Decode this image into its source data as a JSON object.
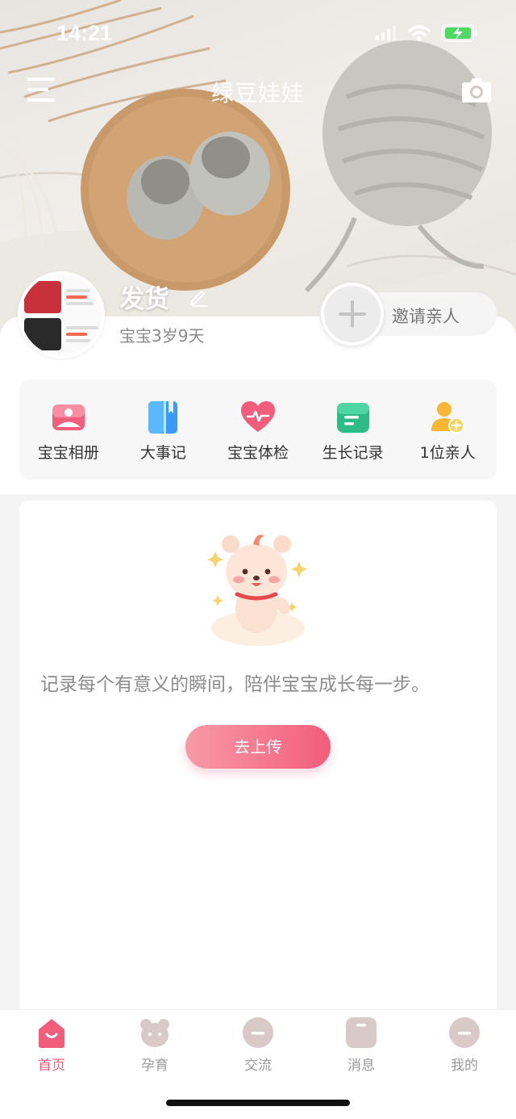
{
  "status": {
    "time": "14:21"
  },
  "header": {
    "title": "绿豆娃娃"
  },
  "profile": {
    "name": "发货",
    "age": "宝宝3岁9天",
    "invite_label": "邀请亲人"
  },
  "features": [
    {
      "label": "宝宝相册",
      "icon": "photo-album-icon"
    },
    {
      "label": "大事记",
      "icon": "notebook-icon"
    },
    {
      "label": "宝宝体检",
      "icon": "heart-checkup-icon"
    },
    {
      "label": "生长记录",
      "icon": "growth-record-icon"
    },
    {
      "label": "1位亲人",
      "icon": "add-relative-icon"
    }
  ],
  "card": {
    "message": "记录每个有意义的瞬间，陪伴宝宝成长每一步。",
    "button_label": "去上传"
  },
  "tabs": [
    {
      "label": "首页",
      "icon": "home-icon",
      "active": true
    },
    {
      "label": "孕育",
      "icon": "bear-icon",
      "active": false
    },
    {
      "label": "交流",
      "icon": "chat-icon",
      "active": false
    },
    {
      "label": "消息",
      "icon": "message-icon",
      "active": false
    },
    {
      "label": "我的",
      "icon": "profile-icon",
      "active": false
    }
  ],
  "colors": {
    "accent": "#f25d7b",
    "tab_inactive": "#d9c9c7"
  }
}
